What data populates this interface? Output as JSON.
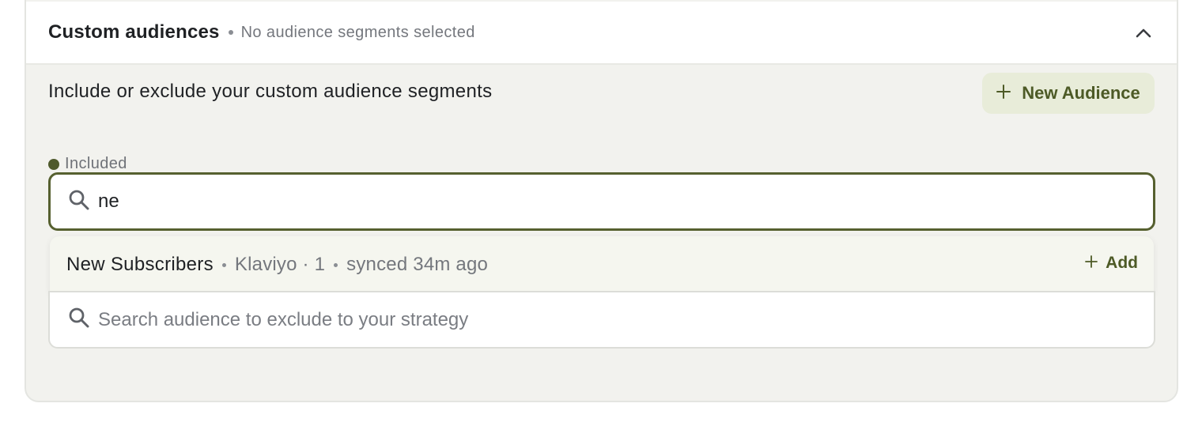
{
  "header": {
    "title": "Custom audiences",
    "subtitle": "No audience segments selected"
  },
  "section": {
    "description": "Include or exclude your custom audience segments",
    "new_audience_label": "New Audience"
  },
  "included": {
    "label": "Included",
    "search_value": "ne"
  },
  "results": [
    {
      "name": "New Subscribers",
      "meta": "Klaviyo · 1",
      "synced": "synced 34m ago",
      "action_label": "Add"
    }
  ],
  "excluded": {
    "placeholder": "Search audience to exclude to your strategy"
  },
  "colors": {
    "accent": "#56602f",
    "accent_text": "#4d5a26",
    "button_bg": "#e8ecd9",
    "panel_bg": "#f2f2ee"
  },
  "icons": {
    "collapse": "chevron-up-icon",
    "add": "plus-icon",
    "search": "search-icon"
  }
}
